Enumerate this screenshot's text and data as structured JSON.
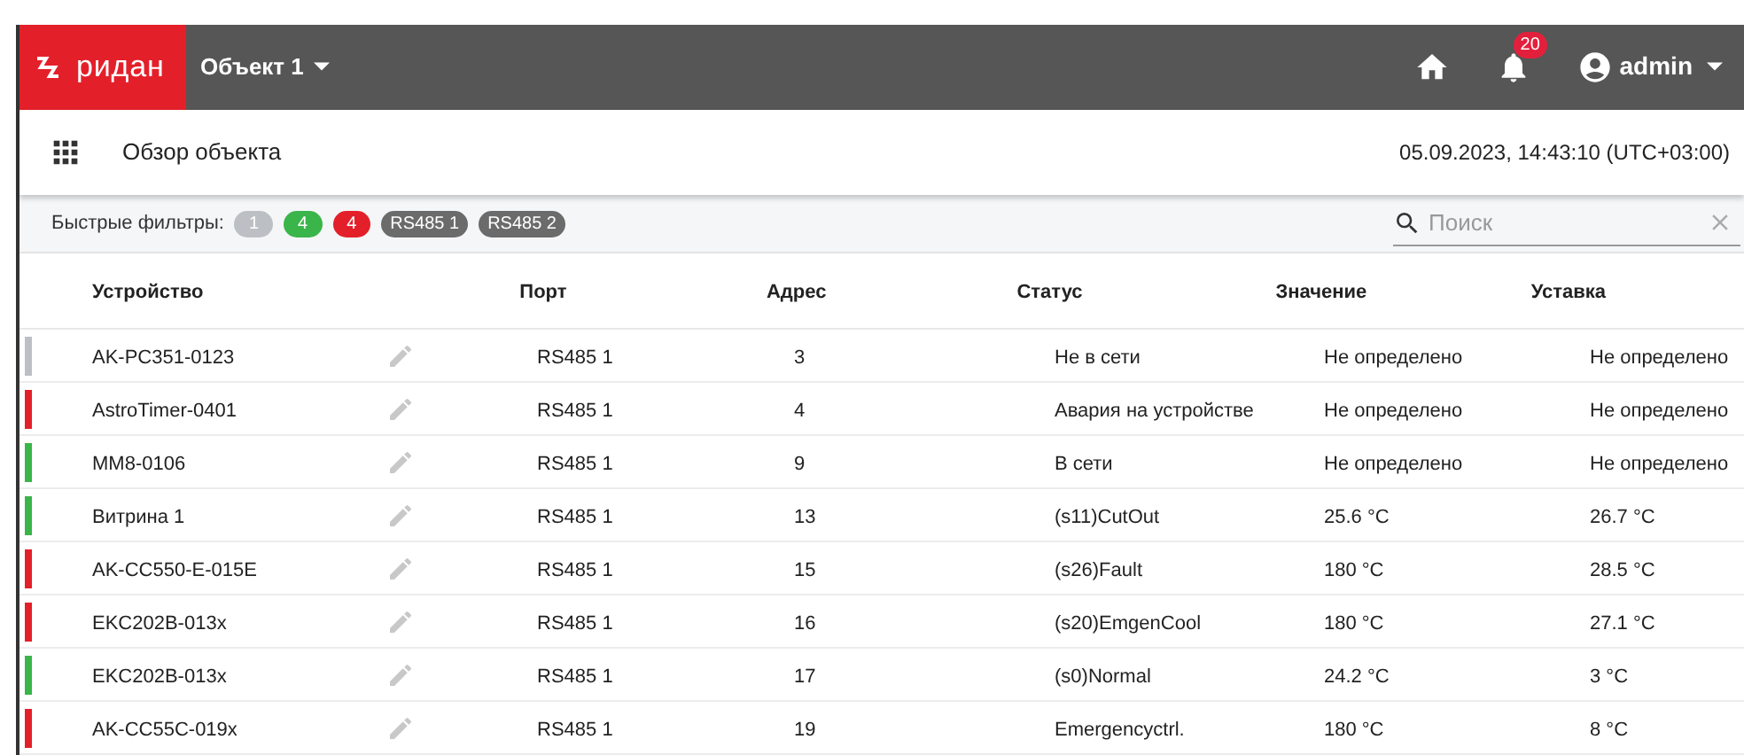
{
  "header": {
    "logo": "ридан",
    "object": "Объект 1",
    "notifications": "20",
    "user": "admin"
  },
  "subheader": {
    "title": "Обзор объекта",
    "datetime": "05.09.2023, 14:43:10 (UTC+03:00)"
  },
  "filters": {
    "label": "Быстрые фильтры:",
    "chips": [
      {
        "label": "1",
        "color": "#bcc0c4"
      },
      {
        "label": "4",
        "color": "#3ab54a"
      },
      {
        "label": "4",
        "color": "#e3202a"
      },
      {
        "label": "RS485 1",
        "color": "#6b6b6b"
      },
      {
        "label": "RS485 2",
        "color": "#6b6b6b"
      }
    ],
    "search": {
      "placeholder": "Поиск"
    }
  },
  "table": {
    "columns": [
      "Устройство",
      "Порт",
      "Адрес",
      "Статус",
      "Значение",
      "Уставка"
    ],
    "rows": [
      {
        "color": "#bcc0c4",
        "cells": [
          "AK-PC351-0123",
          "RS485 1",
          "3",
          "Не в сети",
          "Не определено",
          "Не определено"
        ]
      },
      {
        "color": "#e3202a",
        "cells": [
          "AstroTimer-0401",
          "RS485 1",
          "4",
          "Авария на устройстве",
          "Не определено",
          "Не определено"
        ]
      },
      {
        "color": "#3ab54a",
        "cells": [
          "MM8-0106",
          "RS485 1",
          "9",
          "В сети",
          "Не определено",
          "Не определено"
        ]
      },
      {
        "color": "#3ab54a",
        "cells": [
          "Витрина 1",
          "RS485 1",
          "13",
          "(s11)CutOut",
          "25.6 °C",
          "26.7 °C"
        ]
      },
      {
        "color": "#e3202a",
        "cells": [
          "AK-CC550-E-015E",
          "RS485 1",
          "15",
          "(s26)Fault",
          "180 °C",
          "28.5 °C"
        ]
      },
      {
        "color": "#e3202a",
        "cells": [
          "EKC202B-013x",
          "RS485 1",
          "16",
          "(s20)EmgenCool",
          "180 °C",
          "27.1 °C"
        ]
      },
      {
        "color": "#3ab54a",
        "cells": [
          "EKC202B-013x",
          "RS485 1",
          "17",
          "(s0)Normal",
          "24.2 °C",
          "3 °C"
        ]
      },
      {
        "color": "#e3202a",
        "cells": [
          "AK-CC55C-019x",
          "RS485 1",
          "19",
          "Emergencyctrl.",
          "180 °C",
          "8 °C"
        ]
      }
    ]
  }
}
